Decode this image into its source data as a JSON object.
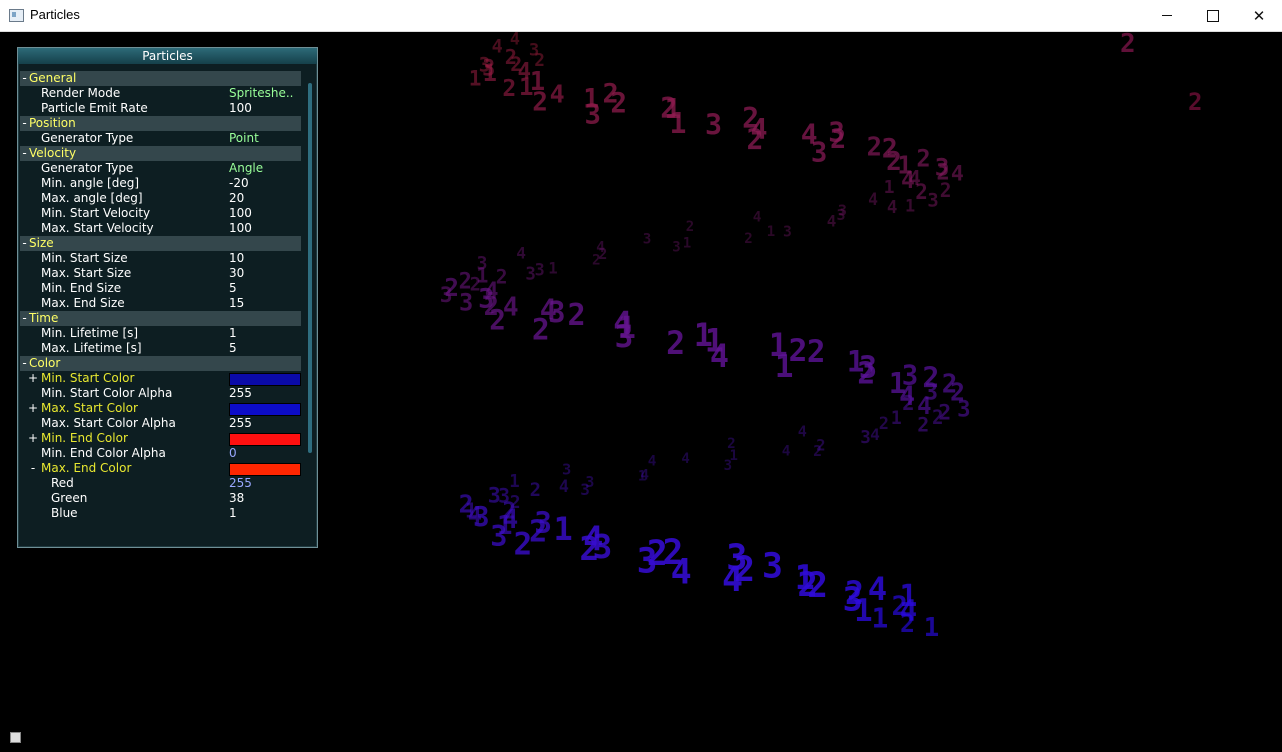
{
  "window": {
    "title": "Particles"
  },
  "panel": {
    "title": "Particles",
    "sections": [
      {
        "label": "General",
        "rows": [
          {
            "name": "Render Mode",
            "value": "Spriteshe..",
            "color": "green"
          },
          {
            "name": "Particle Emit Rate",
            "value": "100",
            "color": "white"
          }
        ]
      },
      {
        "label": "Position",
        "rows": [
          {
            "name": "Generator Type",
            "value": "Point",
            "color": "green"
          }
        ]
      },
      {
        "label": "Velocity",
        "rows": [
          {
            "name": "Generator Type",
            "value": "Angle",
            "color": "green"
          },
          {
            "name": "Min. angle [deg]",
            "value": "-20",
            "color": "white"
          },
          {
            "name": "Max. angle [deg]",
            "value": "20",
            "color": "white"
          },
          {
            "name": "Min. Start Velocity",
            "value": "100",
            "color": "white"
          },
          {
            "name": "Max. Start Velocity",
            "value": "100",
            "color": "white"
          }
        ]
      },
      {
        "label": "Size",
        "rows": [
          {
            "name": "Min. Start Size",
            "value": "10",
            "color": "white"
          },
          {
            "name": "Max. Start Size",
            "value": "30",
            "color": "white"
          },
          {
            "name": "Min. End Size",
            "value": "5",
            "color": "white"
          },
          {
            "name": "Max. End Size",
            "value": "15",
            "color": "white"
          }
        ]
      },
      {
        "label": "Time",
        "rows": [
          {
            "name": "Min. Lifetime [s]",
            "value": "1",
            "color": "white"
          },
          {
            "name": "Max. Lifetime [s]",
            "value": "5",
            "color": "white"
          }
        ]
      },
      {
        "label": "Color",
        "rows": [
          {
            "name": "Min. Start Color",
            "swatch": "#0a0aa8",
            "toggle": "+"
          },
          {
            "name": "Min. Start Color Alpha",
            "value": "255",
            "color": "white"
          },
          {
            "name": "Max. Start Color",
            "swatch": "#0c0cc8",
            "toggle": "+"
          },
          {
            "name": "Max. Start Color Alpha",
            "value": "255",
            "color": "white"
          },
          {
            "name": "Min. End Color",
            "swatch": "#ff1010",
            "toggle": "+"
          },
          {
            "name": "Min. End Color Alpha",
            "value": "0",
            "color": "blue"
          },
          {
            "name": "Max. End Color",
            "swatch": "#ff2601",
            "toggle": "-"
          },
          {
            "name": "Red",
            "value": "255",
            "color": "blue",
            "indent": true
          },
          {
            "name": "Green",
            "value": "38",
            "color": "white",
            "indent": true
          },
          {
            "name": "Blue",
            "value": "1",
            "color": "white",
            "indent": true
          }
        ]
      }
    ]
  },
  "particles": {
    "digits": "2121411243122342342234231223334124231322143334414132424242312222334224321123"
  }
}
